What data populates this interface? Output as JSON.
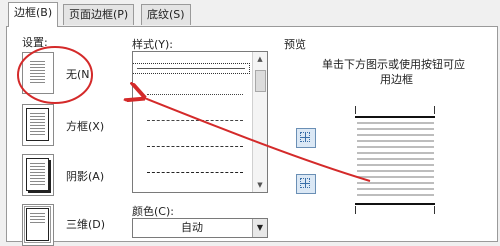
{
  "tabs": [
    {
      "label": "边框(B)"
    },
    {
      "label": "页面边框(P)"
    },
    {
      "label": "底纹(S)"
    }
  ],
  "settings": {
    "label": "设置:",
    "options": [
      {
        "label": "无(N)"
      },
      {
        "label": "方框(X)"
      },
      {
        "label": "阴影(A)"
      },
      {
        "label": "三维(D)"
      }
    ]
  },
  "style": {
    "label": "样式(Y):"
  },
  "color": {
    "label": "颜色(C):",
    "value": "自动"
  },
  "preview": {
    "label": "预览",
    "hint_line1": "单击下方图示或使用按钮可应",
    "hint_line2": "用边框"
  },
  "annotation": {
    "color": "#d42a2a"
  }
}
